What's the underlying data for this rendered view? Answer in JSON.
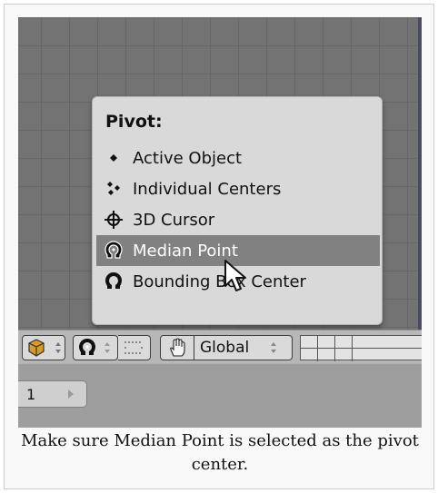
{
  "menu": {
    "title": "Pivot:",
    "items": [
      {
        "label": "Active Object",
        "icon": "dot-icon",
        "selected": false
      },
      {
        "label": "Individual Centers",
        "icon": "individual-centers-icon",
        "selected": false
      },
      {
        "label": "3D Cursor",
        "icon": "crosshair-icon",
        "selected": false
      },
      {
        "label": "Median Point",
        "icon": "median-point-icon",
        "selected": true
      },
      {
        "label": "Bounding Box Center",
        "icon": "bounding-box-icon",
        "selected": false
      }
    ]
  },
  "header": {
    "orientation_value": "Global"
  },
  "layer": {
    "value": "1"
  },
  "caption": "Make sure Median Point is selected as the pivot center.",
  "colors": {
    "selected_item_bg": "#818181",
    "menu_bg": "#d9d9d9",
    "grid_bg": "#737373"
  }
}
